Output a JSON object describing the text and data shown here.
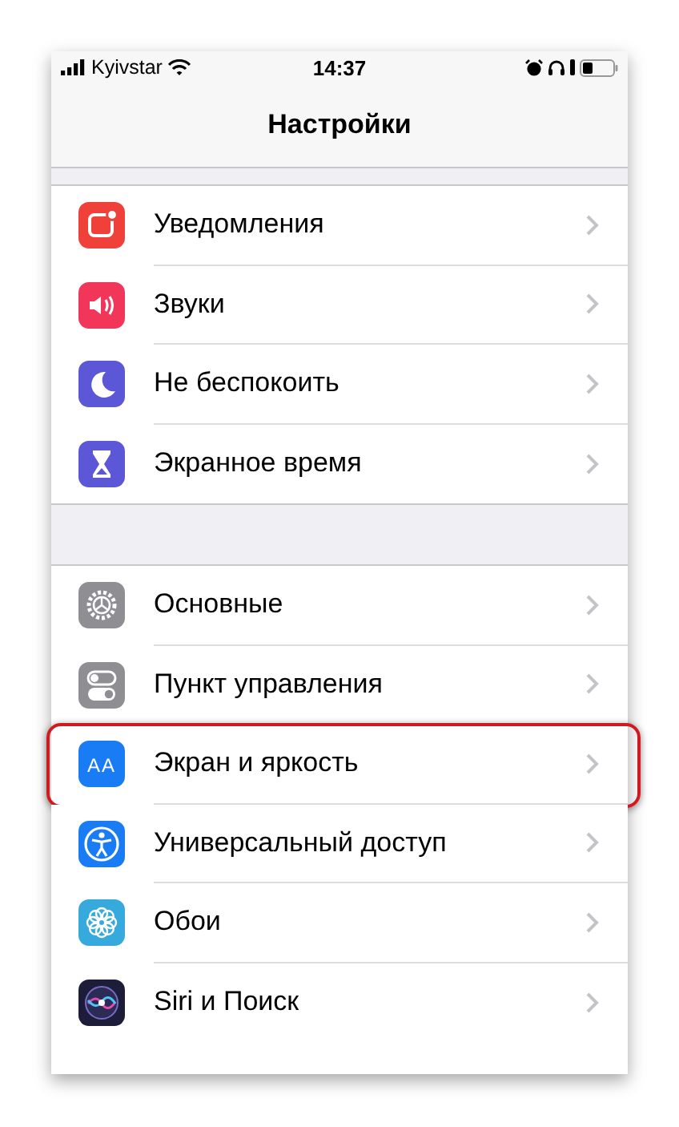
{
  "status_bar": {
    "carrier": "Kyivstar",
    "time": "14:37"
  },
  "title": "Настройки",
  "groups": [
    {
      "rows": [
        {
          "label": "Уведомления",
          "kind": "notifications",
          "color": "#f0403a",
          "highlighted": false
        },
        {
          "label": "Звуки",
          "kind": "sounds",
          "color": "#f2365a",
          "highlighted": false
        },
        {
          "label": "Не беспокоить",
          "kind": "moon",
          "color": "#5b57d6",
          "highlighted": false
        },
        {
          "label": "Экранное время",
          "kind": "hourglass",
          "color": "#5b57d6",
          "highlighted": false
        }
      ]
    },
    {
      "rows": [
        {
          "label": "Основные",
          "kind": "gear",
          "color": "#8e8e93",
          "highlighted": false
        },
        {
          "label": "Пункт управления",
          "kind": "toggles",
          "color": "#8e8e93",
          "highlighted": false
        },
        {
          "label": "Экран и яркость",
          "kind": "glyph",
          "glyph": "AA",
          "color": "#1a7cf5",
          "highlighted": true
        },
        {
          "label": "Универсальный доступ",
          "kind": "person",
          "color": "#1a7cf5",
          "highlighted": false
        },
        {
          "label": "Обои",
          "kind": "flower",
          "color": "#36aadc",
          "highlighted": false
        },
        {
          "label": "Siri и Поиск",
          "kind": "orb",
          "color": "#1d1d3a",
          "highlighted": false
        }
      ]
    }
  ]
}
